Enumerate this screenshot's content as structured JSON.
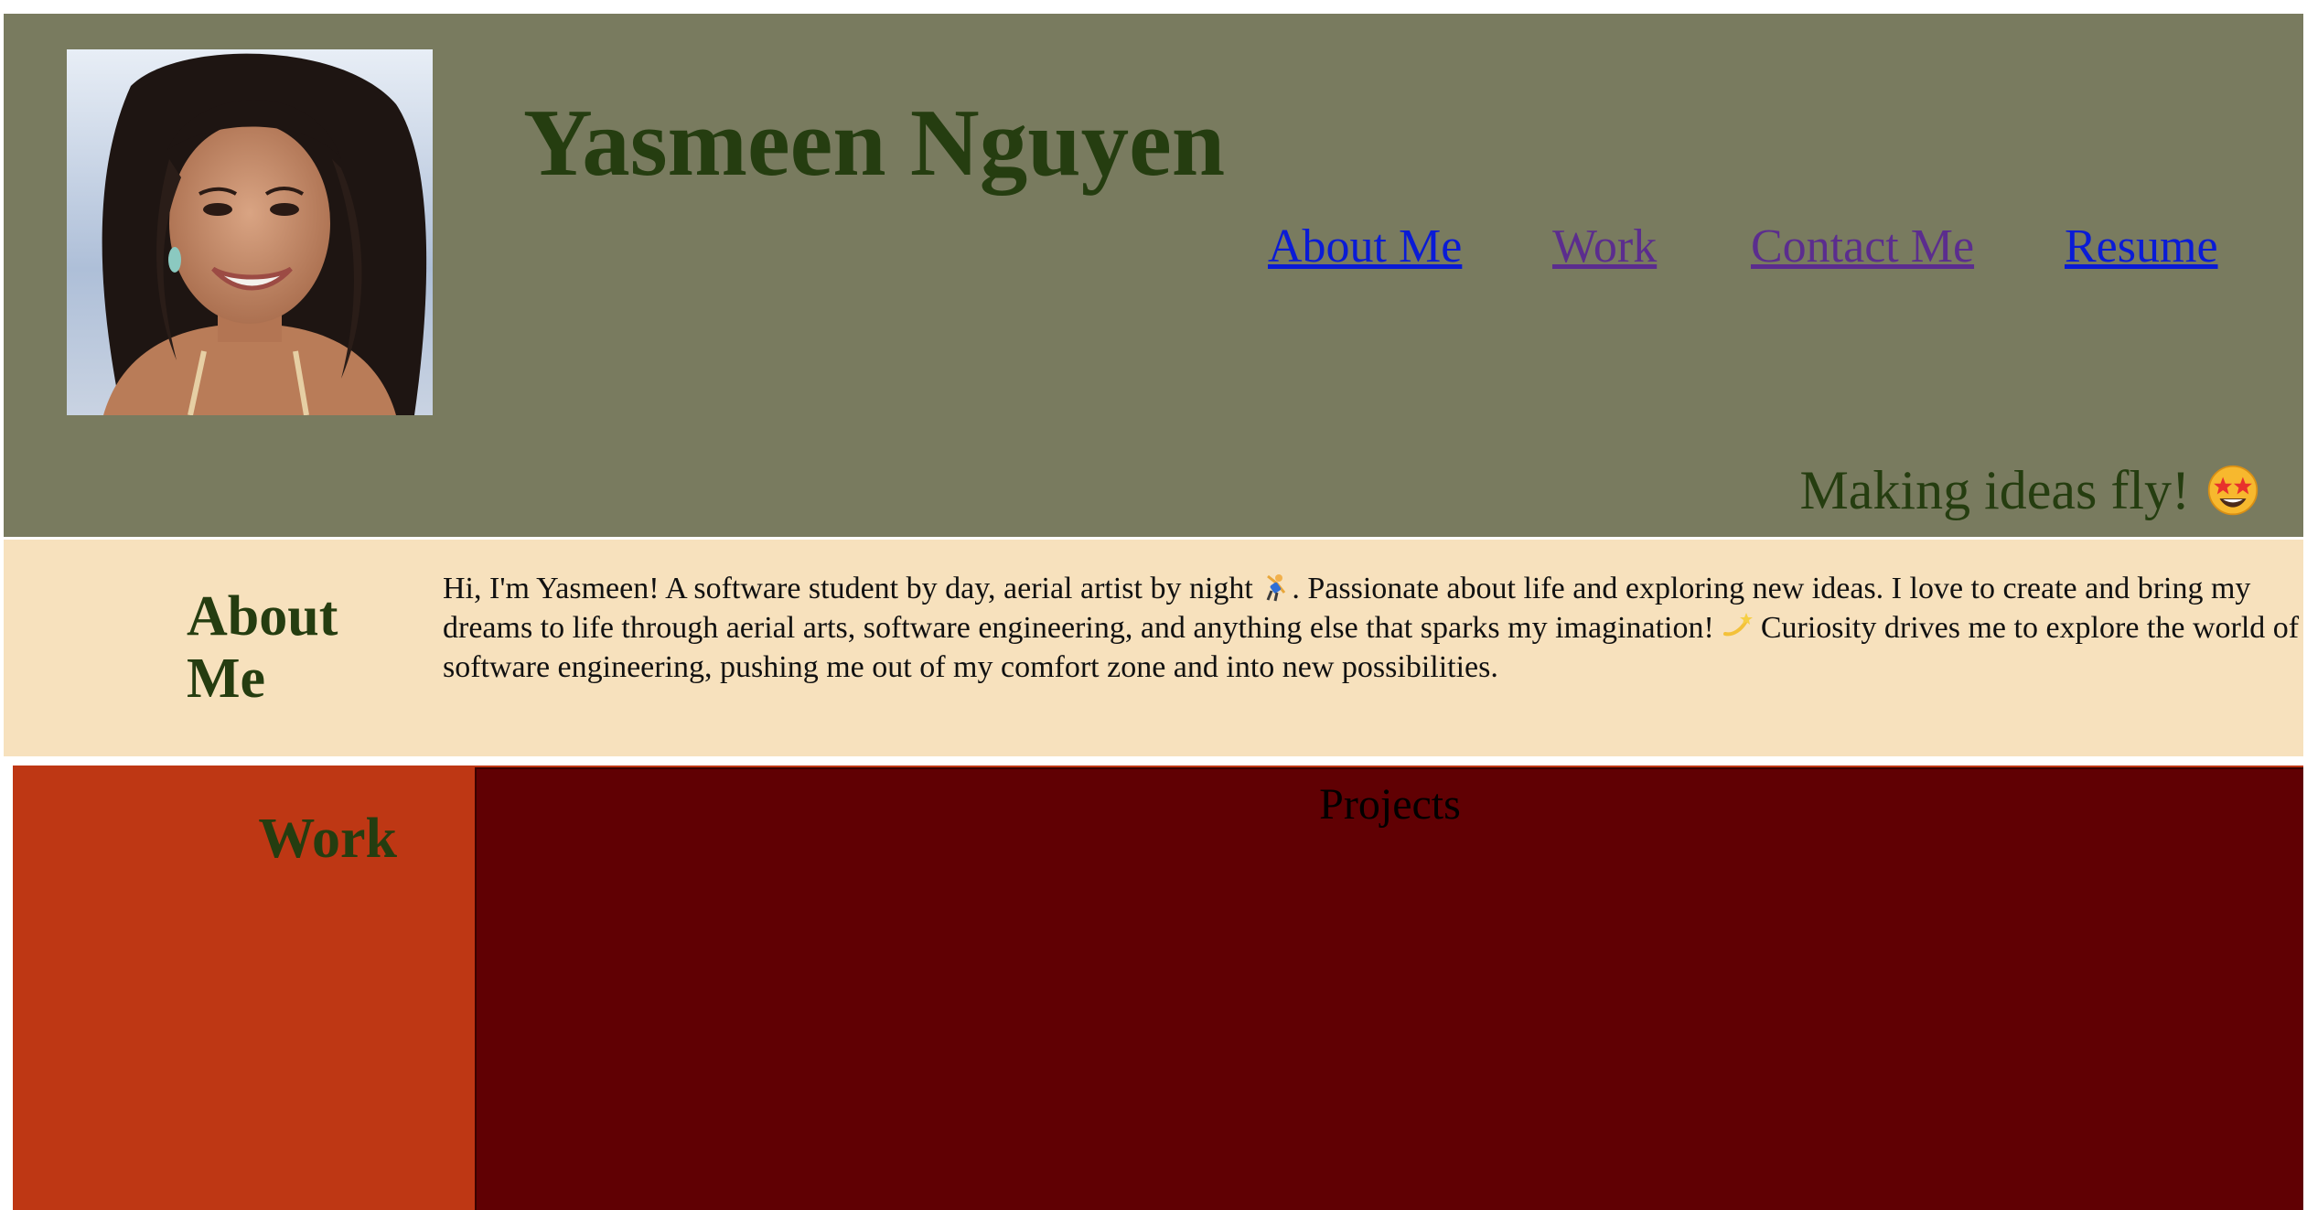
{
  "header": {
    "title": "Yasmeen Nguyen",
    "avatar_alt": "portrait-photo",
    "nav": [
      {
        "label": "About Me",
        "state": "unvisited"
      },
      {
        "label": "Work",
        "state": "visited"
      },
      {
        "label": "Contact Me",
        "state": "visited"
      },
      {
        "label": "Resume",
        "state": "unvisited"
      }
    ],
    "tagline": "Making ideas fly!",
    "tagline_icon": "star-struck-emoji-icon"
  },
  "about": {
    "heading": "About Me",
    "text_part1": "Hi, I'm Yasmeen! A software student by day, aerial artist by night ",
    "text_part2": ". Passionate about life and exploring new ideas. I love to create and bring my dreams to life through aerial arts, software engineering, and anything else that sparks my imagination! ",
    "text_part3": " Curiosity drives me to explore the world of software engineering, pushing me out of my comfort zone and into new possibilities.",
    "emoji_1": "cartwheel-person-emoji-icon",
    "emoji_2": "dizzy-star-emoji-icon"
  },
  "work": {
    "heading": "Work",
    "projects_heading": "Projects"
  },
  "colors": {
    "header_bg": "#797b5f",
    "title_text": "#253d10",
    "about_bg": "#f7e1bd",
    "work_bg": "#be3714",
    "projects_bg": "#600003",
    "link_unvisited": "#0a1bd6",
    "link_visited": "#5b2d8e"
  }
}
